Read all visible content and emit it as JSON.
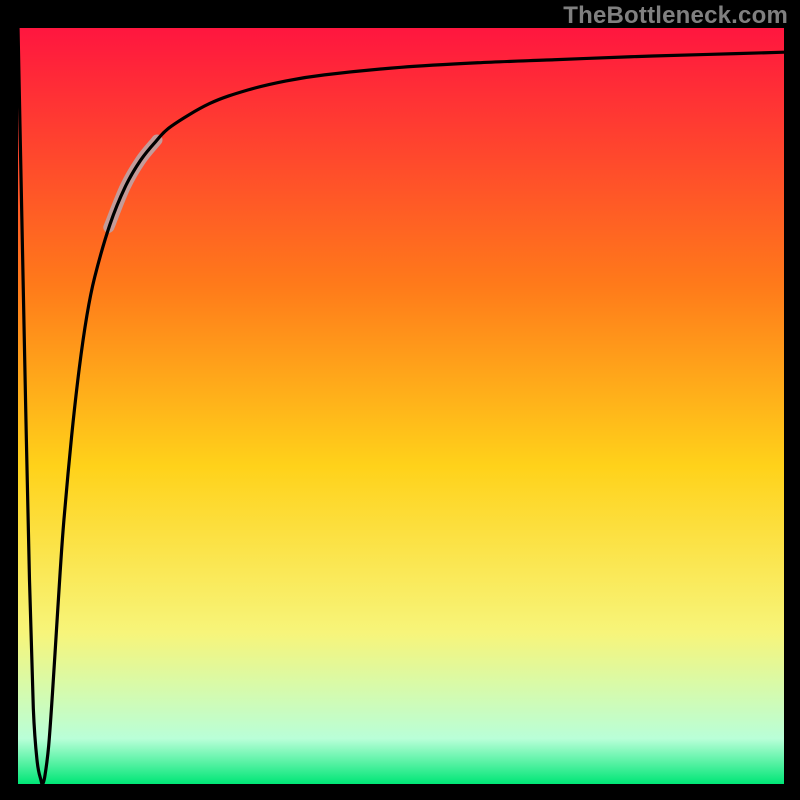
{
  "watermark": "TheBottleneck.com",
  "colors": {
    "frame": "#000000",
    "grad_top": "#ff163f",
    "grad_mid1": "#ff7a1a",
    "grad_mid2": "#ffd21a",
    "grad_mid3": "#f7f57a",
    "grad_bottom": "#b9ffd8",
    "grad_edge": "#00e676",
    "curve": "#000000",
    "highlight": "#c49b99"
  },
  "chart_data": {
    "type": "line",
    "title": "",
    "xlabel": "",
    "ylabel": "",
    "xlim": [
      0,
      100
    ],
    "ylim": [
      0,
      100
    ],
    "series": [
      {
        "name": "bottleneck-curve",
        "x": [
          0.0,
          0.5,
          1.0,
          1.5,
          2.0,
          2.5,
          3.0,
          3.2,
          3.5,
          4.0,
          4.5,
          5.0,
          5.5,
          6.0,
          7.0,
          8.0,
          9.0,
          10.0,
          12.0,
          14.0,
          16.0,
          18.0,
          20.0,
          25.0,
          30.0,
          35.0,
          40.0,
          50.0,
          60.0,
          70.0,
          80.0,
          90.0,
          100.0
        ],
        "y": [
          100.0,
          75.0,
          50.0,
          27.0,
          10.0,
          3.0,
          0.5,
          0.0,
          1.0,
          5.0,
          12.0,
          20.0,
          28.0,
          35.0,
          46.0,
          55.0,
          62.0,
          67.0,
          74.0,
          79.0,
          82.5,
          85.0,
          87.0,
          90.0,
          91.8,
          93.0,
          93.8,
          94.8,
          95.4,
          95.8,
          96.2,
          96.5,
          96.8
        ]
      }
    ],
    "highlight_range_x": [
      12.0,
      18.0
    ]
  }
}
